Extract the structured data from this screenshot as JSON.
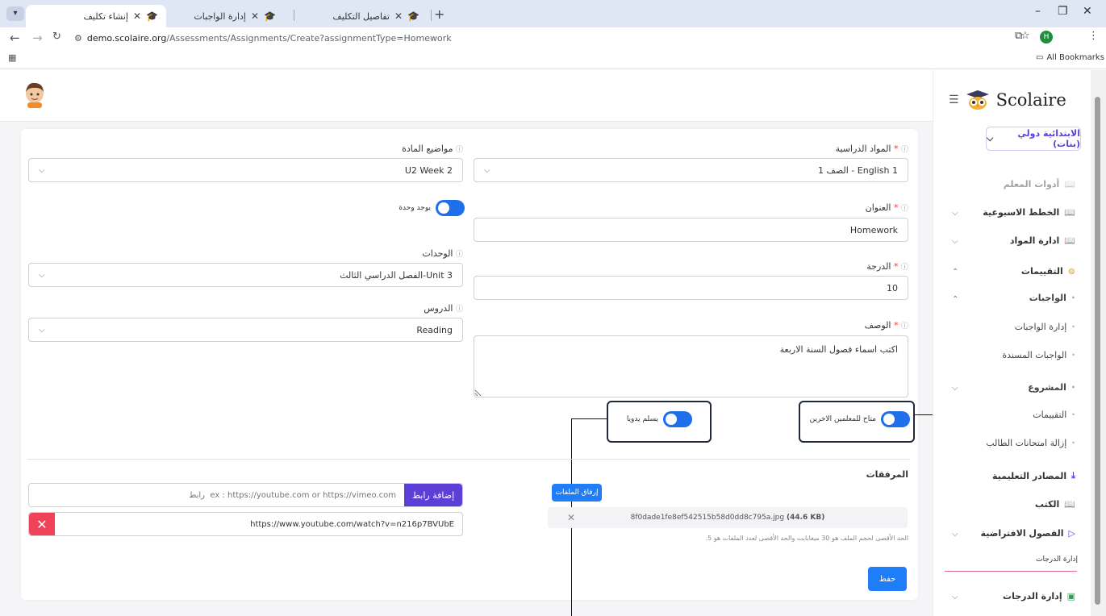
{
  "browser": {
    "tabs": [
      {
        "label": "إنشاء تكليف",
        "active": true
      },
      {
        "label": "إدارة الواجبات",
        "active": false
      },
      {
        "label": "تفاصيل التكليف",
        "active": false
      }
    ],
    "url_host": "demo.scolaire.org",
    "url_path": "/Assessments/Assignments/Create?assignmentType=Homework",
    "profile_initial": "H",
    "bookmarks_label": "All Bookmarks"
  },
  "sidebar": {
    "brand": "Scolaire",
    "school": "الابتدائية دولي (بنات)",
    "items": [
      {
        "label": "أدوات المعلم",
        "icon": "book-icon"
      },
      {
        "label": "الخطط الاسبوعية",
        "icon": "book-icon"
      },
      {
        "label": "ادارة المواد",
        "icon": "book-icon"
      },
      {
        "label": "التقييمات",
        "icon": "assessment-icon"
      },
      {
        "label": "الواجبات",
        "icon": "dot"
      },
      {
        "label": "إدارة الواجبات",
        "icon": "dot"
      },
      {
        "label": "الواجبات المسندة",
        "icon": "dot"
      },
      {
        "label": "المشروع",
        "icon": "dot"
      },
      {
        "label": "التقييمات",
        "icon": "dot"
      },
      {
        "label": "إزالة امتحانات الطالب",
        "icon": "dot"
      },
      {
        "label": "المصادر التعليمية",
        "icon": "download-icon"
      },
      {
        "label": "الكتب",
        "icon": "book-icon"
      },
      {
        "label": "الفصول الافتراضية",
        "icon": "play-icon"
      },
      {
        "label": "إدارة الدرجات",
        "icon": "tooltip"
      },
      {
        "label": "إدارة الدرجات",
        "icon": "grades-icon"
      }
    ]
  },
  "form": {
    "subject_label": "المواد الدراسية",
    "subject_value": "English 1 - الصف 1",
    "topics_label": "مواضيع المادة",
    "topics_value": "U2 Week 2",
    "title_label": "العنوان",
    "title_value": "Homework",
    "unit_toggle_label": "يوجد وحدة",
    "units_label": "الوحدات",
    "units_value": "Unit 3-الفصل الدراسي الثالث",
    "grade_label": "الدرجة",
    "grade_value": "10",
    "lessons_label": "الدروس",
    "lessons_value": "Reading",
    "desc_label": "الوصف",
    "desc_value": "اكتب اسماء فصول السنة الاربعة",
    "manual_toggle_label": "يسلم يدويا",
    "share_toggle_label": "متاح للمعلمين الاخرين",
    "attachments_label": "المرفقات",
    "attach_button": "إرفاق الملفات",
    "file_name": "8f0dade1fe8ef542515b58d0dd8c795a.jpg",
    "file_size": "(44.6 KB)",
    "file_note": "الحد الأقصى لحجم الملف هو 30 ميغابايت والحد الأقصى لعدد الملفات هو 5.",
    "link_placeholder": "ex : https://youtube.com or https://vimeo.com  رابط",
    "add_link_button": "إضافة رابط",
    "link_value": "https://www.youtube.com/watch?v=n216p7BVUbE",
    "save_button": "حفظ"
  },
  "colors": {
    "primary": "#1f7ef7",
    "purple": "#5b3fd6",
    "danger": "#f0435a"
  }
}
